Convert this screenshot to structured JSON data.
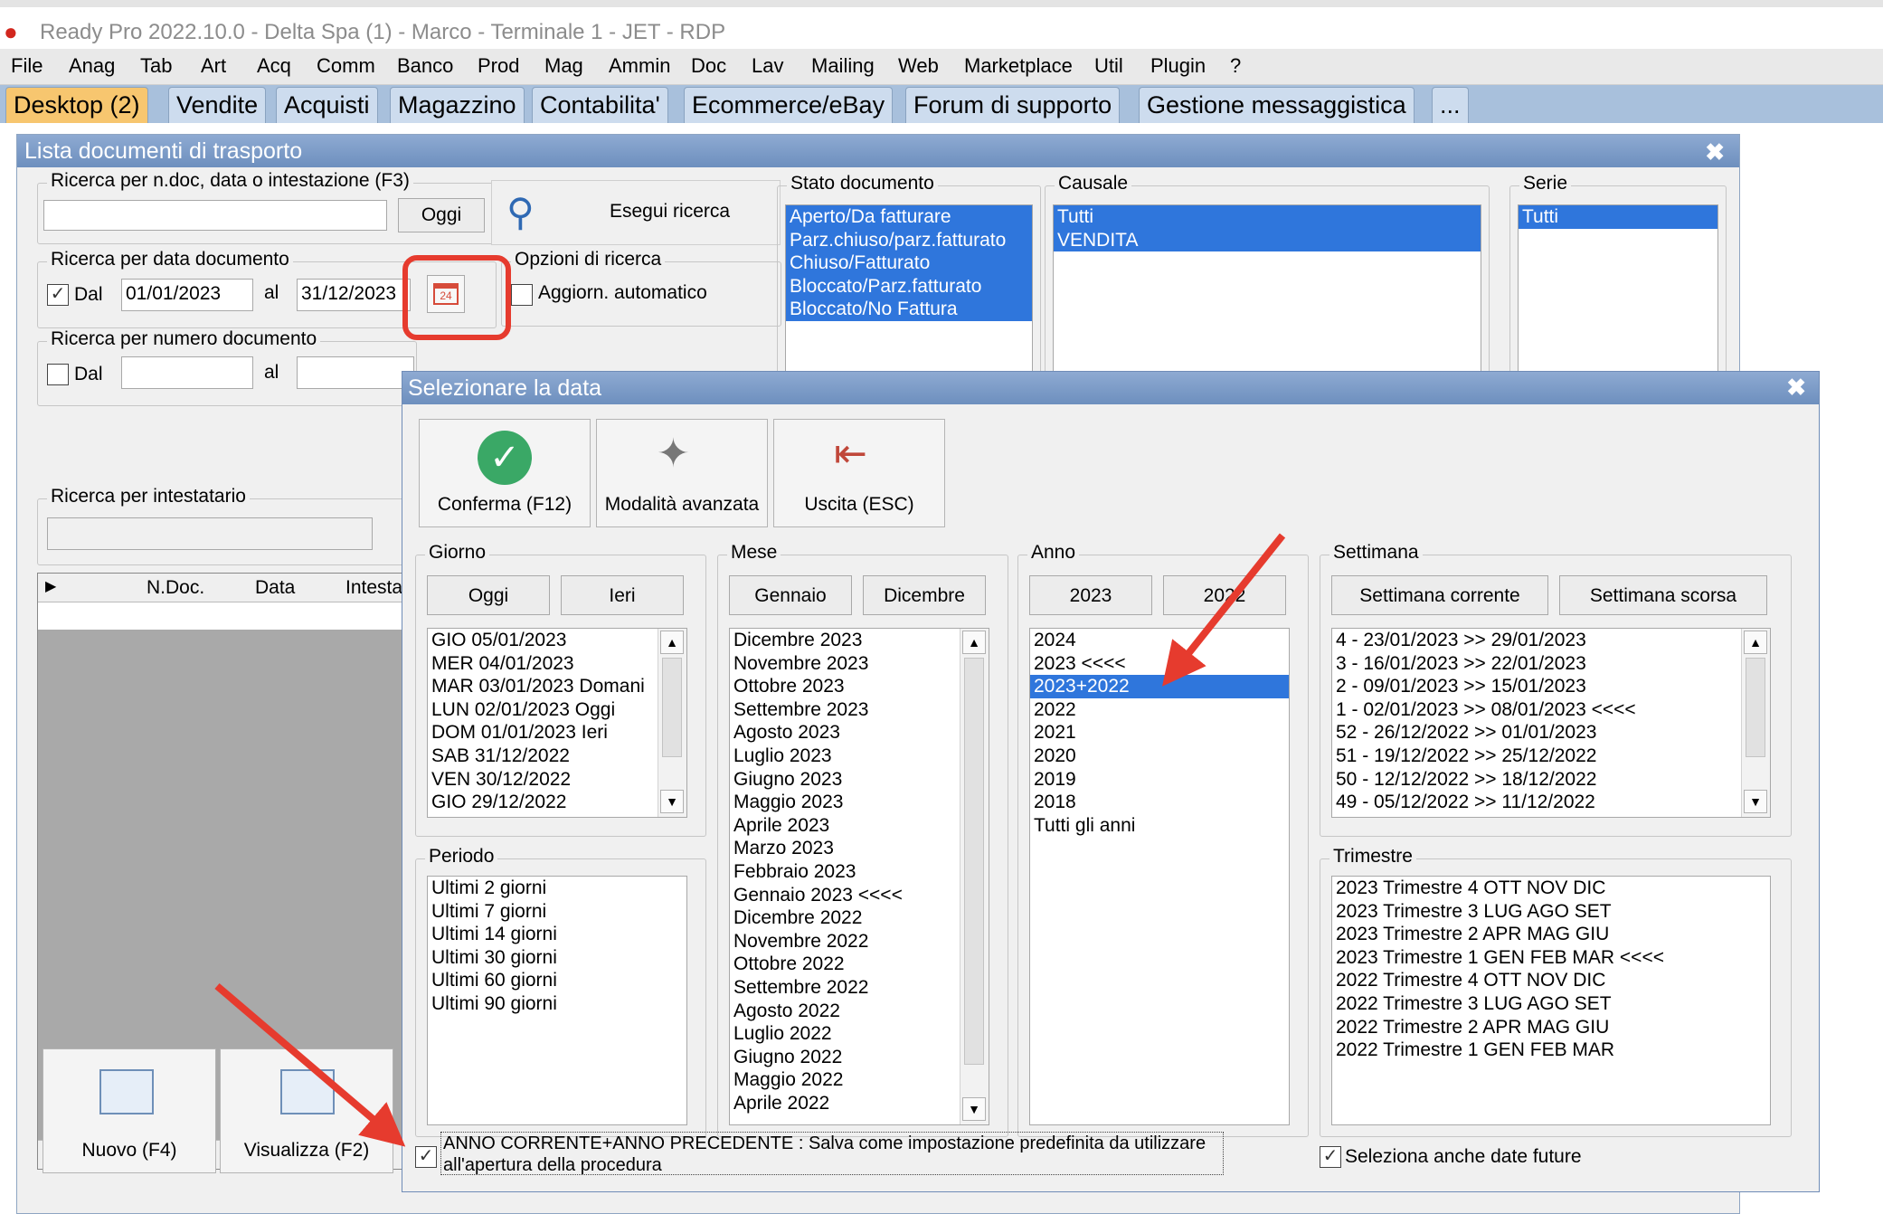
{
  "window": {
    "title": "Ready Pro 2022.10.0 - Delta Spa (1) - Marco - Terminale 1 - JET - RDP"
  },
  "menu": [
    "File",
    "Anag",
    "Tab",
    "Art",
    "Acq",
    "Comm",
    "Banco",
    "Prod",
    "Mag",
    "Ammin",
    "Doc",
    "Lav",
    "Mailing",
    "Web",
    "Marketplace",
    "Util",
    "Plugin",
    "?"
  ],
  "tabs": [
    "Desktop (2)",
    "Vendite",
    "Acquisti",
    "Magazzino",
    "Contabilita'",
    "Ecommerce/eBay",
    "Forum di supporto",
    "Gestione messaggistica",
    "..."
  ],
  "main": {
    "title": "Lista documenti di trasporto",
    "search_label": "Ricerca per n.doc, data o intestazione (F3)",
    "today_btn": "Oggi",
    "run_search": "Esegui ricerca",
    "date_group": "Ricerca per data documento",
    "date_from_label": "Dal",
    "date_from": "01/01/2023",
    "date_to_label": "al",
    "date_to": "31/12/2023",
    "calendar_icon_text": "24",
    "options_group": "Opzioni di ricerca",
    "auto_update": "Aggiorn. automatico",
    "number_group": "Ricerca per numero documento",
    "num_from_label": "Dal",
    "num_to_label": "al",
    "holder_group": "Ricerca per intestatario",
    "status_group": "Stato documento",
    "status_items": [
      "Aperto/Da fatturare",
      "Parz.chiuso/parz.fatturato",
      "Chiuso/Fatturato",
      "Bloccato/Parz.fatturato",
      "Bloccato/No Fattura"
    ],
    "cause_group": "Causale",
    "cause_items": [
      "Tutti",
      "VENDITA"
    ],
    "series_group": "Serie",
    "series_items": [
      "Tutti"
    ],
    "grid_cols": [
      "N.Doc.",
      "Data",
      "Intestata"
    ],
    "new_btn": "Nuovo (F4)",
    "view_btn": "Visualizza (F2)"
  },
  "dialog": {
    "title": "Selezionare la data",
    "confirm": "Conferma (F12)",
    "advanced": "Modalità avanzata",
    "exit": "Uscita (ESC)",
    "giorno": {
      "label": "Giorno",
      "btn1": "Oggi",
      "btn2": "Ieri",
      "items": [
        "GIO 05/01/2023",
        "MER 04/01/2023",
        "MAR 03/01/2023 Domani",
        "LUN 02/01/2023 Oggi",
        "DOM 01/01/2023 Ieri",
        "SAB 31/12/2022",
        "VEN 30/12/2022",
        "GIO 29/12/2022"
      ]
    },
    "periodo": {
      "label": "Periodo",
      "items": [
        "Ultimi 2 giorni",
        "Ultimi 7 giorni",
        "Ultimi 14 giorni",
        "Ultimi 30 giorni",
        "Ultimi 60 giorni",
        "Ultimi 90 giorni"
      ]
    },
    "mese": {
      "label": "Mese",
      "btn1": "Gennaio",
      "btn2": "Dicembre",
      "items": [
        "Dicembre 2023",
        "Novembre 2023",
        "Ottobre 2023",
        "Settembre 2023",
        "Agosto 2023",
        "Luglio 2023",
        "Giugno 2023",
        "Maggio 2023",
        "Aprile 2023",
        "Marzo 2023",
        "Febbraio 2023",
        "Gennaio 2023 <<<<",
        "Dicembre 2022",
        "Novembre 2022",
        "Ottobre 2022",
        "Settembre 2022",
        "Agosto 2022",
        "Luglio 2022",
        "Giugno 2022",
        "Maggio 2022",
        "Aprile 2022"
      ]
    },
    "anno": {
      "label": "Anno",
      "btn1": "2023",
      "btn2": "2022",
      "items": [
        "2024",
        "2023 <<<<",
        "2023+2022",
        "2022",
        "2021",
        "2020",
        "2019",
        "2018",
        "Tutti gli anni"
      ],
      "selected": 2
    },
    "settimana": {
      "label": "Settimana",
      "btn1": "Settimana corrente",
      "btn2": "Settimana scorsa",
      "items": [
        "4 - 23/01/2023 >> 29/01/2023",
        "3 - 16/01/2023 >> 22/01/2023",
        "2 - 09/01/2023 >> 15/01/2023",
        "1 - 02/01/2023 >> 08/01/2023 <<<<",
        "52 - 26/12/2022 >> 01/01/2023",
        "51 - 19/12/2022 >> 25/12/2022",
        "50 - 12/12/2022 >> 18/12/2022",
        "49 - 05/12/2022 >> 11/12/2022"
      ]
    },
    "trimestre": {
      "label": "Trimestre",
      "items": [
        "2023 Trimestre 4 OTT NOV DIC",
        "2023 Trimestre 3 LUG AGO SET",
        "2023 Trimestre 2 APR MAG GIU",
        "2023 Trimestre 1 GEN FEB MAR <<<<",
        "2022 Trimestre 4 OTT NOV DIC",
        "2022 Trimestre 3 LUG AGO SET",
        "2022 Trimestre 2 APR MAG GIU",
        "2022 Trimestre 1 GEN FEB MAR"
      ]
    },
    "default_check": "ANNO CORRENTE+ANNO PRECEDENTE : Salva come impostazione predefinita da utilizzare all'apertura della procedura",
    "future_check": "Seleziona anche date future"
  },
  "colors": {
    "accent": "#2f76dc",
    "annotation": "#e63b2e",
    "active_tab": "#f7c66f"
  }
}
